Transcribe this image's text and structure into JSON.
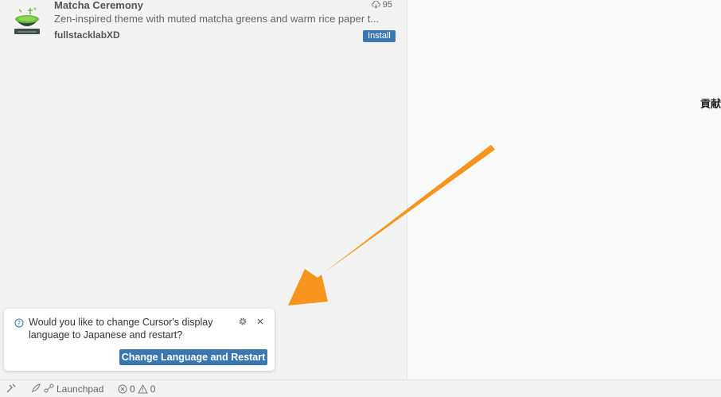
{
  "extension": {
    "name": "Matcha Ceremony",
    "downloads": "95",
    "description": "Zen-inspired theme with muted matcha greens and warm rice paper t...",
    "publisher": "fullstacklabXD",
    "install_label": "Install"
  },
  "editor": {
    "cjk_text": "貢献"
  },
  "notification": {
    "message": "Would you like to change Cursor's display language to Japanese and restart?",
    "action_label": "Change Language and Restart"
  },
  "statusbar": {
    "launchpad_label": "Launchpad",
    "errors": "0",
    "warnings": "0"
  },
  "colors": {
    "accent": "#3a77b0",
    "arrow": "#f7941d"
  }
}
